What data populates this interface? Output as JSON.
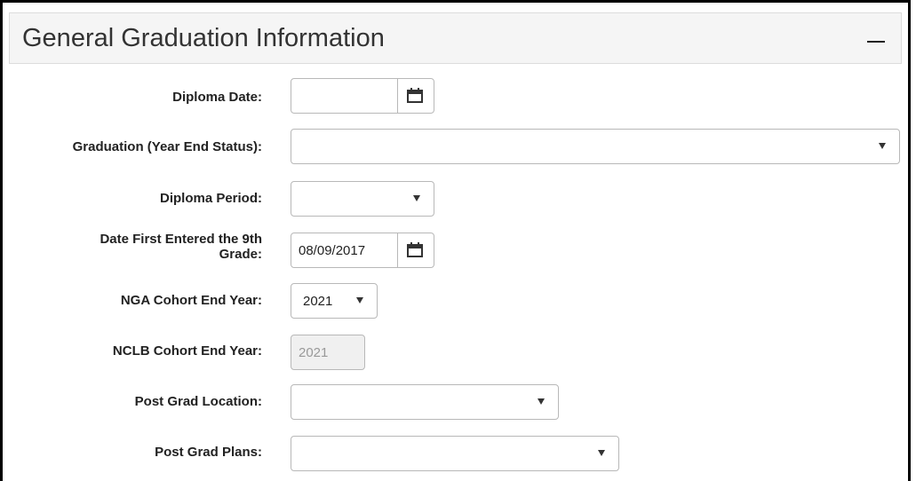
{
  "panel": {
    "title": "General Graduation Information"
  },
  "fields": {
    "diploma_date": {
      "label": "Diploma Date:",
      "value": ""
    },
    "graduation_status": {
      "label": "Graduation (Year End Status):",
      "value": ""
    },
    "diploma_period": {
      "label": "Diploma Period:",
      "value": ""
    },
    "date_first_9th": {
      "label_line1": "Date First Entered the 9th",
      "label_line2": "Grade:",
      "value": "08/09/2017"
    },
    "nga_cohort": {
      "label": "NGA Cohort End Year:",
      "value": "2021"
    },
    "nclb_cohort": {
      "label": "NCLB Cohort End Year:",
      "value": "2021"
    },
    "post_grad_location": {
      "label": "Post Grad Location:",
      "value": ""
    },
    "post_grad_plans": {
      "label": "Post Grad Plans:",
      "value": ""
    }
  },
  "icons": {
    "calendar": "calendar-icon",
    "dropdown": "chevron-down-icon",
    "collapse": "minus-icon"
  }
}
